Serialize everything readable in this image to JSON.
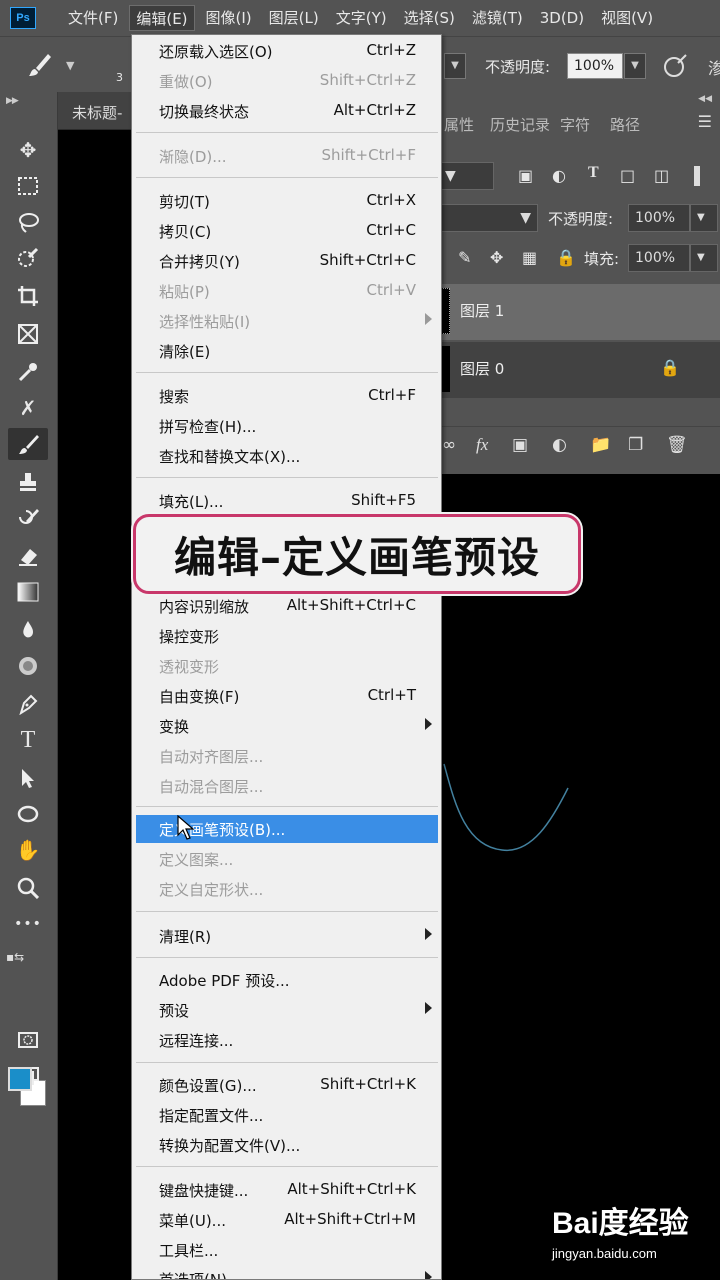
{
  "menubar": {
    "logo": "Ps",
    "items": [
      "文件(F)",
      "编辑(E)",
      "图像(I)",
      "图层(L)",
      "文字(Y)",
      "选择(S)",
      "滤镜(T)",
      "3D(D)",
      "视图(V)"
    ]
  },
  "options": {
    "brush_size_partial": "3",
    "opacity_label": "不透明度:",
    "opacity_value": "100%"
  },
  "document": {
    "tab_name": "未标题-"
  },
  "panels": {
    "tabs": [
      "属性",
      "历史记录",
      "字符",
      "路径"
    ],
    "layer_opacity_label": "不透明度:",
    "layer_opacity_value": "100%",
    "fill_label": "填充:",
    "fill_value": "100%",
    "layers": [
      {
        "name": "图层 1",
        "selected": true
      },
      {
        "name": "图层 0",
        "selected": false,
        "locked": true
      }
    ]
  },
  "edit_menu": {
    "items": [
      {
        "label": "还原载入选区(O)",
        "shortcut": "Ctrl+Z",
        "disabled": false
      },
      {
        "label": "重做(O)",
        "shortcut": "Shift+Ctrl+Z",
        "disabled": true
      },
      {
        "label": "切换最终状态",
        "shortcut": "Alt+Ctrl+Z",
        "disabled": false
      },
      {
        "label": "渐隐(D)...",
        "shortcut": "Shift+Ctrl+F",
        "disabled": true
      },
      {
        "label": "剪切(T)",
        "shortcut": "Ctrl+X",
        "disabled": false
      },
      {
        "label": "拷贝(C)",
        "shortcut": "Ctrl+C",
        "disabled": false
      },
      {
        "label": "合并拷贝(Y)",
        "shortcut": "Shift+Ctrl+C",
        "disabled": false
      },
      {
        "label": "粘贴(P)",
        "shortcut": "Ctrl+V",
        "disabled": true
      },
      {
        "label": "选择性粘贴(I)",
        "shortcut": "",
        "disabled": true,
        "submenu": true
      },
      {
        "label": "清除(E)",
        "shortcut": "",
        "disabled": false
      },
      {
        "label": "搜索",
        "shortcut": "Ctrl+F",
        "disabled": false
      },
      {
        "label": "拼写检查(H)...",
        "shortcut": "",
        "disabled": false
      },
      {
        "label": "查找和替换文本(X)...",
        "shortcut": "",
        "disabled": false
      },
      {
        "label": "填充(L)...",
        "shortcut": "Shift+F5",
        "disabled": false
      },
      {
        "label": "内容识别缩放",
        "shortcut": "Alt+Shift+Ctrl+C",
        "disabled": false
      },
      {
        "label": "操控变形",
        "shortcut": "",
        "disabled": false
      },
      {
        "label": "透视变形",
        "shortcut": "",
        "disabled": true
      },
      {
        "label": "自由变换(F)",
        "shortcut": "Ctrl+T",
        "disabled": false
      },
      {
        "label": "变换",
        "shortcut": "",
        "disabled": false,
        "submenu": true
      },
      {
        "label": "自动对齐图层...",
        "shortcut": "",
        "disabled": true
      },
      {
        "label": "自动混合图层...",
        "shortcut": "",
        "disabled": true
      },
      {
        "label": "定义画笔预设(B)...",
        "shortcut": "",
        "disabled": false,
        "highlighted": true
      },
      {
        "label": "定义图案...",
        "shortcut": "",
        "disabled": true
      },
      {
        "label": "定义自定形状...",
        "shortcut": "",
        "disabled": true
      },
      {
        "label": "清理(R)",
        "shortcut": "",
        "disabled": false,
        "submenu": true
      },
      {
        "label": "Adobe PDF 预设...",
        "shortcut": "",
        "disabled": false
      },
      {
        "label": "预设",
        "shortcut": "",
        "disabled": false,
        "submenu": true
      },
      {
        "label": "远程连接...",
        "shortcut": "",
        "disabled": false
      },
      {
        "label": "颜色设置(G)...",
        "shortcut": "Shift+Ctrl+K",
        "disabled": false
      },
      {
        "label": "指定配置文件...",
        "shortcut": "",
        "disabled": false
      },
      {
        "label": "转换为配置文件(V)...",
        "shortcut": "",
        "disabled": false
      },
      {
        "label": "键盘快捷键...",
        "shortcut": "Alt+Shift+Ctrl+K",
        "disabled": false
      },
      {
        "label": "菜单(U)...",
        "shortcut": "Alt+Shift+Ctrl+M",
        "disabled": false
      },
      {
        "label": "工具栏...",
        "shortcut": "",
        "disabled": false
      },
      {
        "label": "首选项(N)",
        "shortcut": "",
        "disabled": false,
        "submenu": true
      }
    ]
  },
  "caption": "编辑–定义画笔预设",
  "watermark": {
    "logo": "Bai度经验",
    "url": "jingyan.baidu.com"
  },
  "colors": {
    "foreground": "#1a8ec9",
    "background": "#ffffff",
    "menu_highlight": "#3a8ee6",
    "caption_border": "#c8376a"
  }
}
